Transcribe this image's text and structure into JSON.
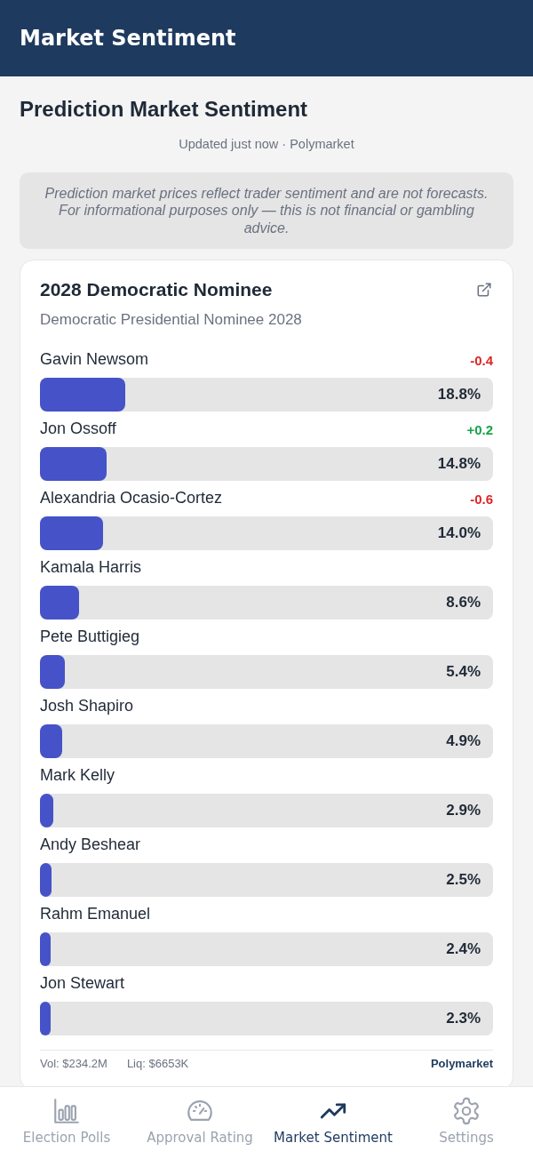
{
  "header": {
    "title": "Market Sentiment"
  },
  "page": {
    "title": "Prediction Market Sentiment",
    "updated": "Updated just now · Polymarket",
    "disclaimer": "Prediction market prices reflect trader sentiment and are not forecasts. For informational purposes only — this is not financial or gambling advice."
  },
  "market": {
    "title": "2028 Democratic Nominee",
    "subtitle": "Democratic Presidential Nominee 2028",
    "candidates": [
      {
        "name": "Gavin Newsom",
        "change": "-0.4",
        "color": "#dc2626",
        "level": 0.188,
        "percent": "18.8%"
      },
      {
        "name": "Jon Ossoff",
        "change": "+0.2",
        "color": "#16a34a",
        "level": 0.148,
        "percent": "14.8%"
      },
      {
        "name": "Alexandria Ocasio-Cortez",
        "change": "-0.6",
        "color": "#dc2626",
        "level": 0.14,
        "percent": "14.0%"
      },
      {
        "name": "Kamala Harris",
        "level": 0.086,
        "percent": "8.6%"
      },
      {
        "name": "Pete Buttigieg",
        "level": 0.054,
        "percent": "5.4%"
      },
      {
        "name": "Josh Shapiro",
        "level": 0.049,
        "percent": "4.9%"
      },
      {
        "name": "Mark Kelly",
        "level": 0.029,
        "percent": "2.9%"
      },
      {
        "name": "Andy Beshear",
        "level": 0.025,
        "percent": "2.5%"
      },
      {
        "name": "Rahm Emanuel",
        "level": 0.024,
        "percent": "2.4%"
      },
      {
        "name": "Jon Stewart",
        "level": 0.023,
        "percent": "2.3%"
      }
    ],
    "volume": "Vol: $234.2M",
    "liquidity": "Liq: $6653K",
    "source": "Polymarket"
  },
  "nav": [
    {
      "label": "Election Polls",
      "selected": false
    },
    {
      "label": "Approval Rating",
      "selected": false
    },
    {
      "label": "Market Sentiment",
      "selected": true
    },
    {
      "label": "Settings",
      "selected": false
    }
  ]
}
